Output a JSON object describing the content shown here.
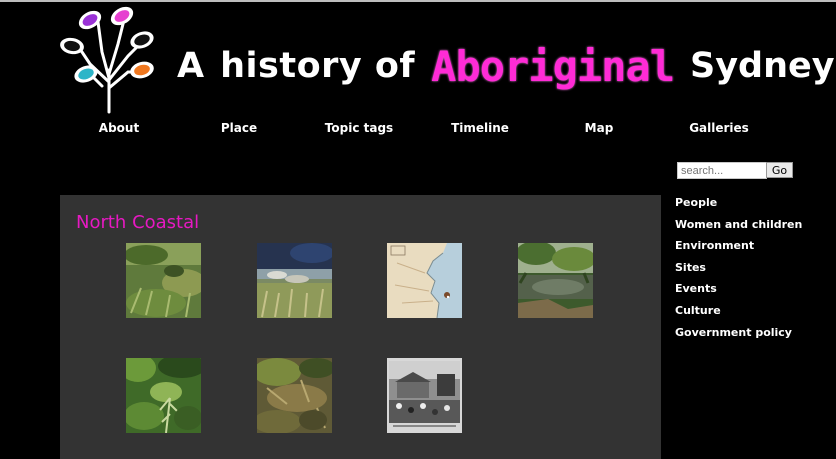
{
  "header": {
    "title_part1": "A",
    "title_part2": "history of",
    "title_highlight": "Aboriginal",
    "title_part3": "Sydney",
    "highlight_color": "#ff2bd6"
  },
  "nav": {
    "items": [
      "About",
      "Place",
      "Topic tags",
      "Timeline",
      "Map",
      "Galleries"
    ]
  },
  "search": {
    "placeholder": "search...",
    "button_label": "Go"
  },
  "sidebar": {
    "items": [
      "People",
      "Women and children",
      "Environment",
      "Sites",
      "Events",
      "Culture",
      "Government policy"
    ]
  },
  "main": {
    "heading": "North Coastal",
    "heading_color": "#e619c2",
    "thumbnails": [
      {
        "subject": "grassy creek bank photo"
      },
      {
        "subject": "river and rocks photo"
      },
      {
        "subject": "coastal map"
      },
      {
        "subject": "lake with trees photo"
      },
      {
        "subject": "bush and ferns photo"
      },
      {
        "subject": "rock shelter with leaves photo"
      },
      {
        "subject": "historic black-and-white photo"
      }
    ]
  }
}
